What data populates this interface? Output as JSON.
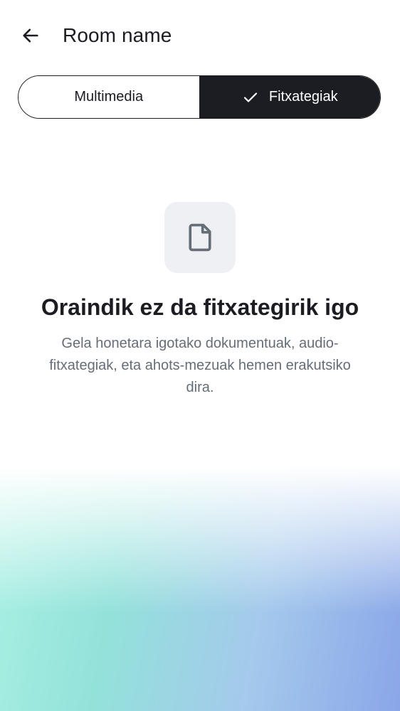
{
  "header": {
    "title": "Room name",
    "back_icon": "arrow-left-icon"
  },
  "tabs": [
    {
      "label": "Multimedia",
      "selected": false
    },
    {
      "label": "Fitxategiak",
      "selected": true,
      "icon": "check-icon"
    }
  ],
  "empty_state": {
    "icon": "file-icon",
    "title": "Oraindik ez da fitxategirik igo",
    "description": "Gela honetara igotako dokumentuak, audio-fitxategiak, eta ahots-mezuak hemen erakutsiko dira."
  },
  "colors": {
    "primary": "#1b1d22",
    "secondary_text": "#656d77",
    "icon_background": "#eef0f4",
    "gradient_teal": "#93e2da",
    "gradient_blue": "#8aa6e8"
  }
}
